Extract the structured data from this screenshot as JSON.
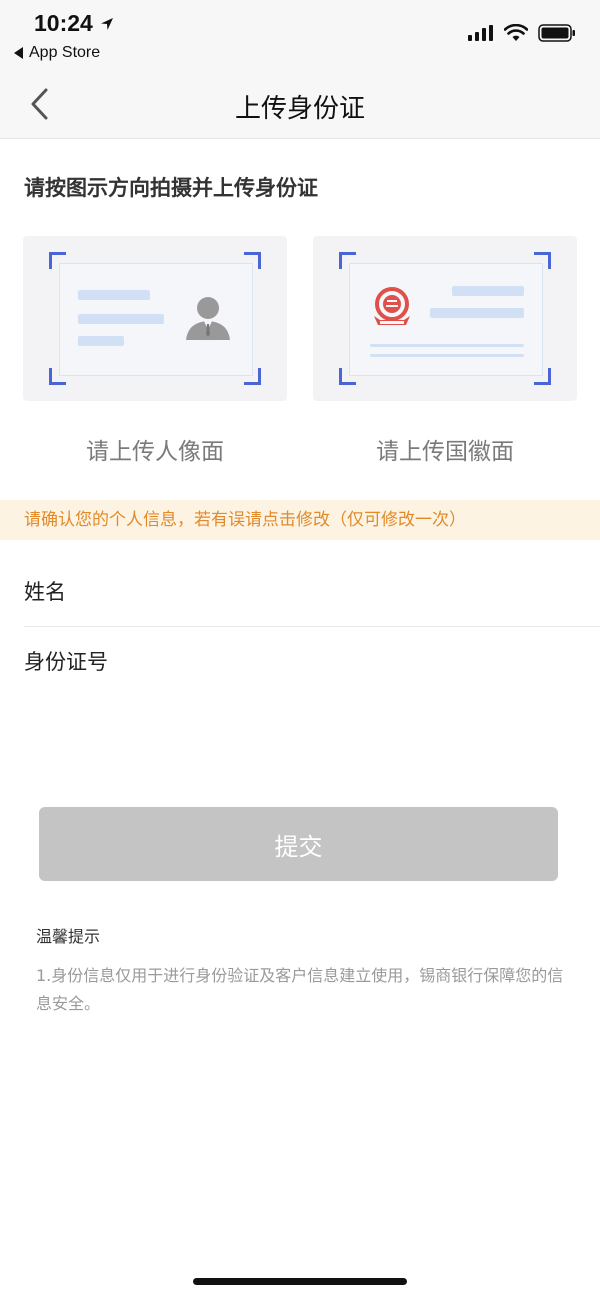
{
  "status_bar": {
    "time": "10:24",
    "back_app_label": "App Store"
  },
  "nav": {
    "title": "上传身份证"
  },
  "instruction": "请按图示方向拍摄并上传身份证",
  "cards": {
    "front_caption": "请上传人像面",
    "back_caption": "请上传国徽面"
  },
  "notice": "请确认您的个人信息，若有误请点击修改（仅可修改一次）",
  "form": {
    "name_label": "姓名",
    "id_label": "身份证号"
  },
  "submit_label": "提交",
  "tips": {
    "title": "温馨提示",
    "text": "1.身份信息仅用于进行身份验证及客户信息建立使用，锡商银行保障您的信息安全。"
  },
  "colors": {
    "accent_blue": "#4a66d6",
    "notice_text": "#e28a2a",
    "notice_bg": "#fdf3e3",
    "button_disabled": "#c4c4c4",
    "emblem_red": "#e0504a"
  }
}
